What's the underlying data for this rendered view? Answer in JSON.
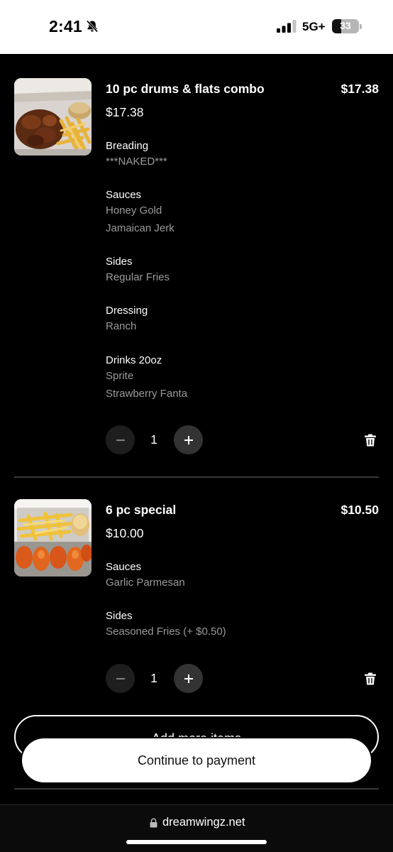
{
  "status_bar": {
    "time": "2:41",
    "network": "5G+",
    "battery": "33",
    "battery_level": 0.33,
    "icons": [
      "bell-slash-icon",
      "signal-bars-icon",
      "battery-icon"
    ]
  },
  "cart": {
    "items": [
      {
        "name": "10 pc drums & flats combo",
        "total": "$17.38",
        "unit_price": "$17.38",
        "thumbnail": "wings-and-fries-photo",
        "options": [
          {
            "title": "Breading",
            "values": [
              "***NAKED***"
            ]
          },
          {
            "title": "Sauces",
            "values": [
              "Honey Gold",
              "Jamaican Jerk"
            ]
          },
          {
            "title": "Sides",
            "values": [
              "Regular Fries"
            ]
          },
          {
            "title": "Dressing",
            "values": [
              "Ranch"
            ]
          },
          {
            "title": "Drinks 20oz",
            "values": [
              "Sprite",
              "Strawberry Fanta"
            ]
          }
        ],
        "quantity": "1"
      },
      {
        "name": "6 pc special",
        "total": "$10.50",
        "unit_price": "$10.00",
        "thumbnail": "wings-and-fries-tray-photo",
        "options": [
          {
            "title": "Sauces",
            "values": [
              "Garlic Parmesan"
            ]
          },
          {
            "title": "Sides",
            "values": [
              "Seasoned Fries (+ $0.50)"
            ]
          }
        ],
        "quantity": "1"
      }
    ],
    "add_more_label": "Add more items",
    "continue_label": "Continue to payment"
  },
  "browser": {
    "url": "dreamwingz.net"
  },
  "colors": {
    "background": "#000000",
    "muted_text": "#9a9a9a",
    "primary_button": "#ffffff"
  }
}
